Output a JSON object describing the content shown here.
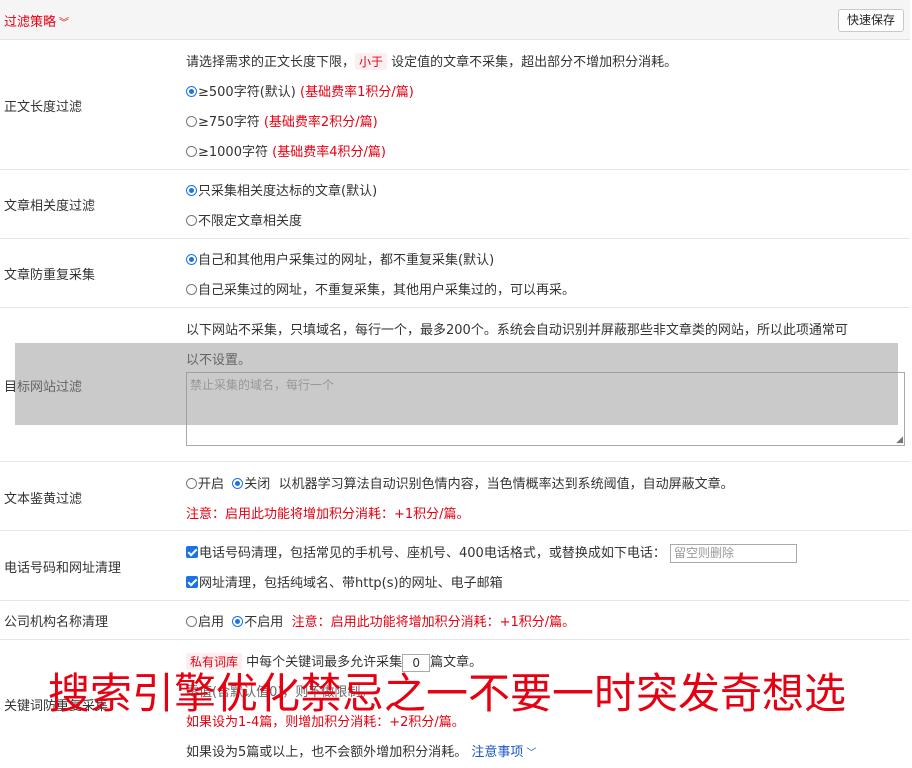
{
  "header": {
    "title": "过滤策略",
    "save_label": "快速保存"
  },
  "length_filter": {
    "label": "正文长度过滤",
    "desc_pre": "请选择需求的正文长度下限，",
    "desc_tag": "小于",
    "desc_post": "设定值的文章不采集，超出部分不增加积分消耗。",
    "options": [
      {
        "text": "≥500字符(默认)",
        "note": "(基础费率1积分/篇)",
        "selected": true
      },
      {
        "text": "≥750字符",
        "note": "(基础费率2积分/篇)",
        "selected": false
      },
      {
        "text": "≥1000字符",
        "note": "(基础费率4积分/篇)",
        "selected": false
      }
    ]
  },
  "relevance_filter": {
    "label": "文章相关度过滤",
    "options": [
      {
        "text": "只采集相关度达标的文章(默认)",
        "selected": true
      },
      {
        "text": "不限定文章相关度",
        "selected": false
      }
    ]
  },
  "duplicate_filter": {
    "label": "文章防重复采集",
    "options": [
      {
        "text": "自己和其他用户采集过的网址，都不重复采集(默认)",
        "selected": true
      },
      {
        "text": "自己采集过的网址，不重复采集，其他用户采集过的，可以再采。",
        "selected": false
      }
    ]
  },
  "site_filter": {
    "label": "目标网站过滤",
    "desc_line1": "以下网站不采集，只填域名，每行一个，最多200个。系统会自动识别并屏蔽那些非文章类的网站，所以此项通常可",
    "desc_line2": "以不设置。",
    "placeholder": "禁止采集的域名，每行一个"
  },
  "porn_filter": {
    "label": "文本鉴黄过滤",
    "on_label": "开启",
    "off_label": "关闭",
    "selected": "off",
    "desc": "以机器学习算法自动识别色情内容，当色情概率达到系统阈值，自动屏蔽文章。",
    "note": "注意：启用此功能将增加积分消耗：+1积分/篇。"
  },
  "phone_filter": {
    "label": "电话号码和网址清理",
    "phone_text": "电话号码清理，包括常见的手机号、座机号、400电话格式，或替换成如下电话：",
    "phone_placeholder": "留空则删除",
    "url_text": "网址清理，包括纯域名、带http(s)的网址、电子邮箱"
  },
  "org_filter": {
    "label": "公司机构名称清理",
    "on_label": "启用",
    "off_label": "不启用",
    "selected": "off",
    "note": "注意：启用此功能将增加积分消耗：+1积分/篇。"
  },
  "keyword_filter": {
    "label": "关键词防重复采集",
    "tag": "私有词库",
    "line1_pre": "中每个关键词最多允许采集",
    "count": "0",
    "line1_post": "篇文章。",
    "line2": "零值(含默认值0)，则不做限制。",
    "line3": "如果设为1-4篇，则增加积分消耗：+2积分/篇。",
    "line4": "如果设为5篇或以上，也不会额外增加积分消耗。",
    "link": "注意事项"
  },
  "watermark": "搜索引擎优化禁忌之一不要一时突发奇想选"
}
